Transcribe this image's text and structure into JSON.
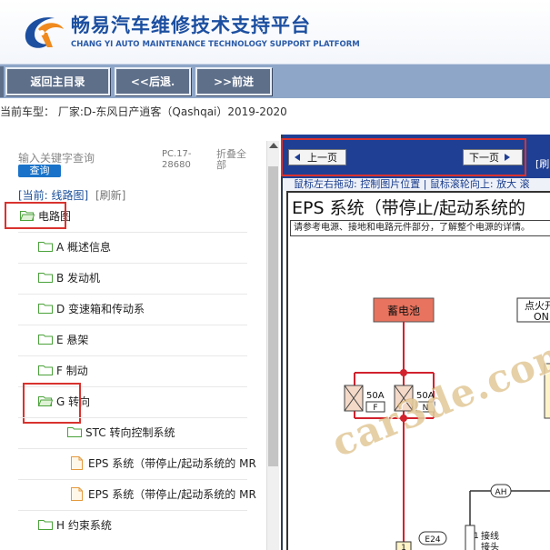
{
  "header": {
    "title": "畅易汽车维修技术支持平台",
    "subtitle": "CHANG YI AUTO MAINTENANCE TECHNOLOGY SUPPORT PLATFORM",
    "logo_icon": "cy-logo-icon"
  },
  "nav": {
    "home_label": "返回主目录",
    "back_label": "<<后退.",
    "forward_label": ">>前进"
  },
  "vehicle": "当前车型： 厂家:D-东风日产逍客（Qashqai）2019-2020",
  "sidebar": {
    "search_placeholder": "输入关键字查询",
    "search_button": "查询",
    "pc_code": "PC.17-28680",
    "fold_all": "折叠全部",
    "current_path": "[当前: 线路图]",
    "refresh": "[刷新]",
    "items": [
      {
        "label": "电路图",
        "icon": "folder-open-icon"
      },
      {
        "label": "A 概述信息",
        "icon": "folder-icon"
      },
      {
        "label": "B 发动机",
        "icon": "folder-icon"
      },
      {
        "label": "D 变速箱和传动系",
        "icon": "folder-icon"
      },
      {
        "label": "E 悬架",
        "icon": "folder-icon"
      },
      {
        "label": "F 制动",
        "icon": "folder-icon"
      },
      {
        "label": "G 转向",
        "icon": "folder-open-icon"
      },
      {
        "label": "STC 转向控制系统",
        "icon": "folder-icon"
      },
      {
        "label": "EPS 系统（带停止/起动系统的 MR",
        "icon": "document-icon"
      },
      {
        "label": "EPS 系统（带停止/起动系统的 MR",
        "icon": "document-icon"
      },
      {
        "label": "H 约束系统",
        "icon": "folder-icon"
      }
    ]
  },
  "viewer": {
    "prev_label": "上一页",
    "next_label": "下一页",
    "refresh_label": "[刷",
    "hint": "鼠标左右拖动: 控制图片位置 | 鼠标滚轮向上: 放大   滚",
    "diagram_title": "EPS 系统（带停止/起动系统的",
    "diagram_note": "请参考电源、接地和电路元件部分，了解整个电源的详情。",
    "battery_label": "蓄电池",
    "ignition_label_1": "点火开",
    "ignition_label_2": "ON",
    "fuse1_value": "50A",
    "fuse1_code": "F",
    "fuse2_value": "50A",
    "fuse2_code": "N",
    "connector_ah": "AH",
    "connector_e24": "E24",
    "pin_number": "1",
    "splice_label_1": "接线",
    "splice_label_2": "接头",
    "splice_code": "M16",
    "watermark": "car3de.com",
    "colors": {
      "battery_fill": "#e8735e",
      "wire_red": "#d2222e",
      "fuse_fill": "#f4d9c8"
    }
  }
}
